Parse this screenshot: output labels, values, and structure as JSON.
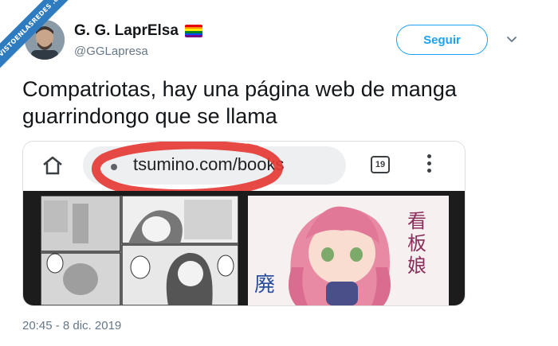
{
  "watermark": {
    "ribbon_text": "VISTOENLASREDES .com"
  },
  "author": {
    "display_name": "G. G. LaprElsa",
    "handle": "@GGLapresa",
    "flag_colors": [
      "#e40303",
      "#ff8c00",
      "#ffed00",
      "#008026",
      "#004dff",
      "#750787"
    ]
  },
  "actions": {
    "follow_label": "Seguir"
  },
  "tweet": {
    "text": "Compatriotas, hay una página web de manga guarrindongo que se llama",
    "timestamp": "20:45 - 8 dic. 2019"
  },
  "media": {
    "browser": {
      "url": "tsumino.com/books",
      "tab_count": "19"
    },
    "manga_right_kanji": "看板娘"
  },
  "colors": {
    "accent": "#1da1f2",
    "annotation_red": "#e53935"
  }
}
